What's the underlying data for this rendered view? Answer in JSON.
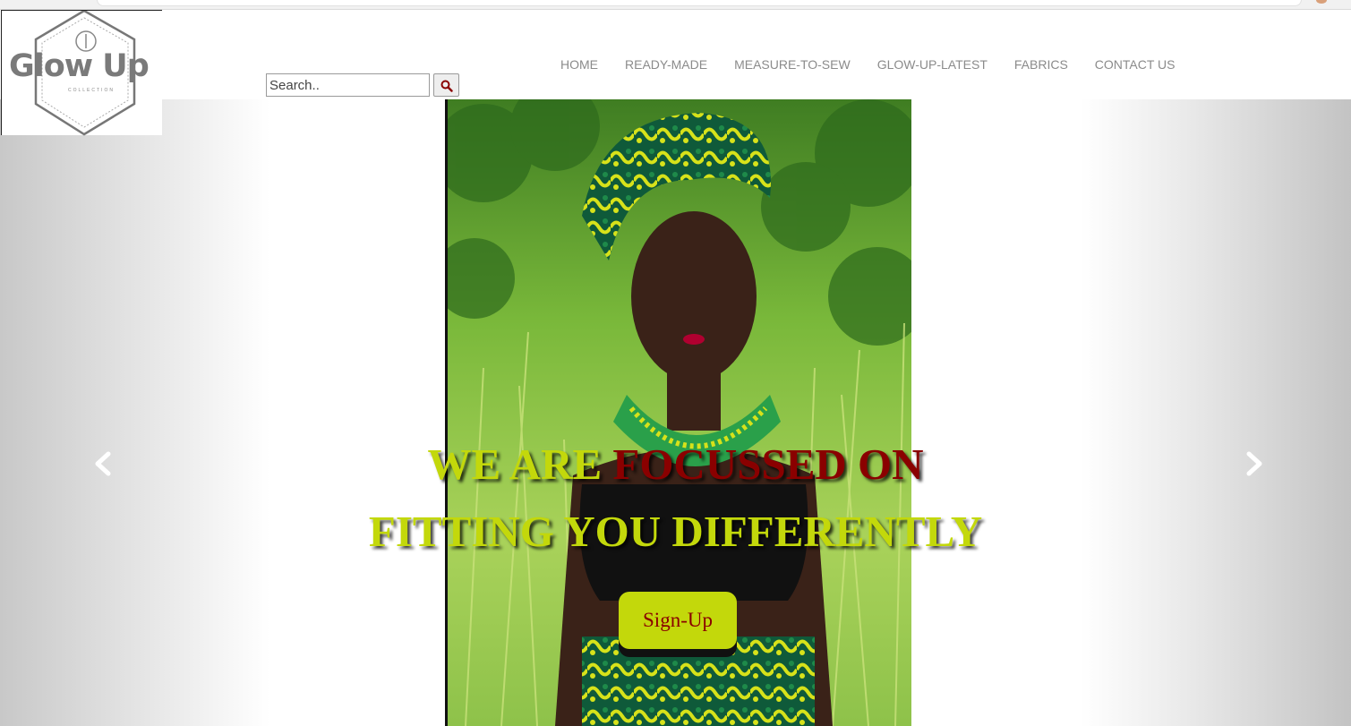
{
  "brand": {
    "logo_text": "Glow Up",
    "logo_subtext": "COLLECTION"
  },
  "search": {
    "placeholder": "Search..",
    "icon": "search-icon"
  },
  "nav": {
    "items": [
      {
        "label": "HOME"
      },
      {
        "label": "READY-MADE"
      },
      {
        "label": "MEASURE-TO-SEW"
      },
      {
        "label": "GLOW-UP-LATEST"
      },
      {
        "label": "FABRICS"
      },
      {
        "label": "CONTACT US"
      }
    ]
  },
  "hero": {
    "line1_part1": "WE ARE ",
    "line1_part2": "FOCUSSED ON",
    "line2": "FITTING YOU DIFFERENTLY",
    "cta_label": "Sign-Up",
    "prev_icon": "chevron-left-icon",
    "next_icon": "chevron-right-icon"
  },
  "colors": {
    "accent_yellow": "#c3d80b",
    "accent_red": "#8a0000",
    "nav_text": "#8b8b8b"
  }
}
